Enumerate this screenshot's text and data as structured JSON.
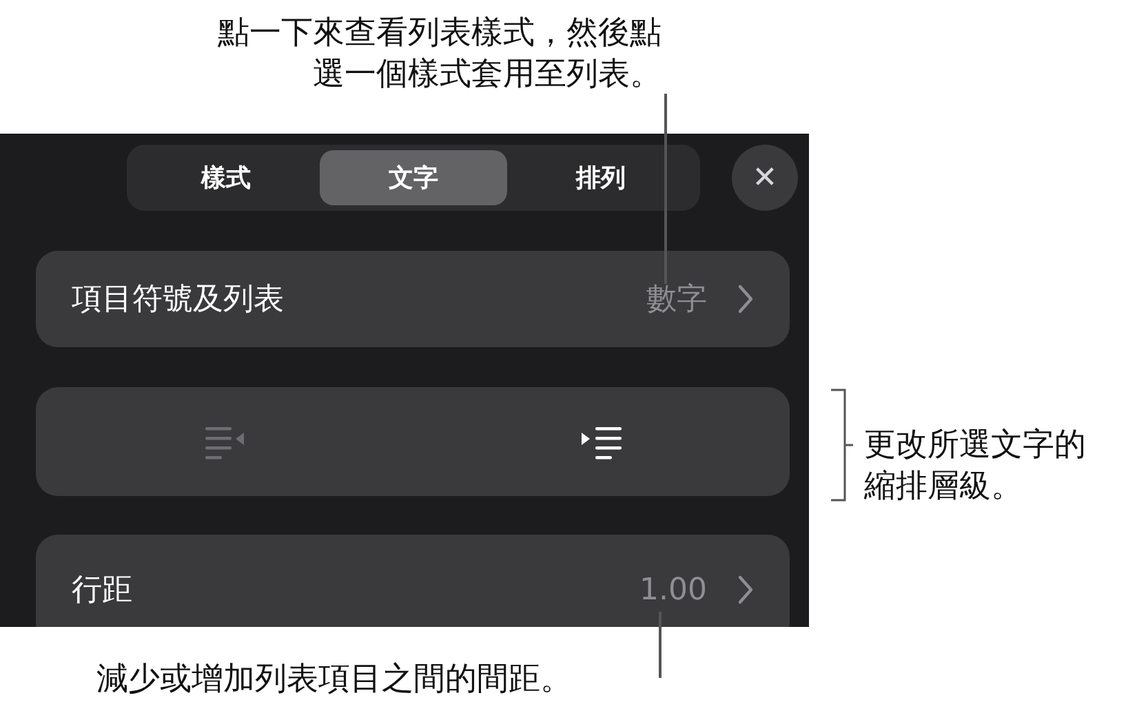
{
  "callouts": [
    {
      "kind": "top",
      "lines": [
        "點一下來查看列表樣式，然後點",
        "選一個樣式套用至列表。"
      ]
    },
    {
      "kind": "right",
      "lines": [
        "更改所選文字的",
        "縮排層級。"
      ]
    },
    {
      "kind": "bottom",
      "lines": [
        "減少或增加列表項目之間的間距。"
      ]
    }
  ],
  "tabs": [
    {
      "label": "樣式",
      "selected": false
    },
    {
      "label": "文字",
      "selected": true
    },
    {
      "label": "排列",
      "selected": false
    }
  ],
  "close_button": "✕",
  "rows": [
    {
      "kind": "value",
      "label": "項目符號及列表",
      "value": "數字"
    },
    {
      "kind": "indent",
      "buttons": [
        {
          "kind": "decrease",
          "disabled": true
        },
        {
          "kind": "increase",
          "disabled": false
        }
      ]
    },
    {
      "kind": "value",
      "label": "行距",
      "value": "1.00"
    }
  ]
}
